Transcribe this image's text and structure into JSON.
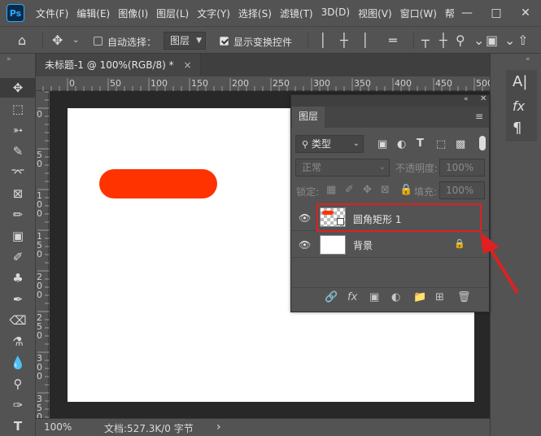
{
  "app": {
    "logo": "Ps"
  },
  "menu": [
    "文件(F)",
    "编辑(E)",
    "图像(I)",
    "图层(L)",
    "文字(Y)",
    "选择(S)",
    "滤镜(T)",
    "3D(D)",
    "视图(V)",
    "窗口(W)",
    "帮"
  ],
  "options": {
    "auto_select_label": "自动选择：",
    "auto_select_value": "图层",
    "show_transform_label": "显示变换控件"
  },
  "document": {
    "tab_title": "未标题-1 @ 100%(RGB/8) *",
    "close_glyph": "×"
  },
  "ruler": {
    "h_ticks": [
      "0",
      "50",
      "100",
      "150",
      "200",
      "250",
      "300",
      "350",
      "400",
      "450",
      "500"
    ],
    "v_ticks": [
      "0",
      "5\n0",
      "1\n0\n0",
      "1\n5\n0",
      "2\n0\n0",
      "2\n5\n0",
      "3\n0\n0",
      "3\n5\n0"
    ]
  },
  "status": {
    "zoom": "100%",
    "doc_info": "文档:527.3K/0 字节",
    "arrow": "›"
  },
  "layers_panel": {
    "tab": "图层",
    "filter_type": "类型",
    "blend_mode": "正常",
    "opacity_label": "不透明度:",
    "opacity_value": "100%",
    "lock_label": "锁定:",
    "fill_label": "填充:",
    "fill_value": "100%",
    "layers": [
      {
        "name": "圆角矩形 1",
        "selected": true
      },
      {
        "name": "背景",
        "locked": true
      }
    ]
  },
  "colors": {
    "shape_fill": "#ff3300",
    "highlight": "#e02020",
    "annotation_arrow": "#e02020"
  }
}
